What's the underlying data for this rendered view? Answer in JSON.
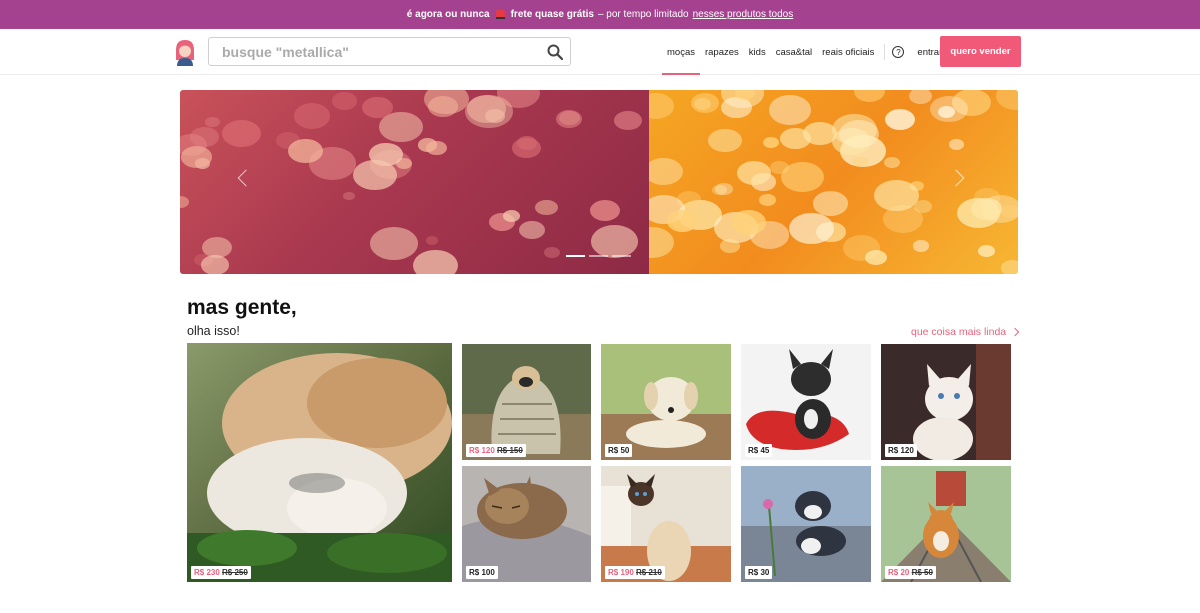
{
  "promo": {
    "part1": "é agora ou nunca",
    "part2": "frete quase grátis",
    "part3": "– por tempo limitado",
    "link": "nesses produtos todos"
  },
  "header": {
    "search_placeholder": "busque \"metallica\"",
    "nav": [
      "moças",
      "rapazes",
      "kids",
      "casa&tal",
      "reais oficiais"
    ],
    "active_nav": "moças",
    "login": "entrar",
    "sell_button": "quero vender",
    "help_glyph": "?"
  },
  "carousel": {
    "slide_count": 3,
    "active_slide": 1
  },
  "section": {
    "title": "mas gente,",
    "subtitle": "olha isso!",
    "see_more": "que coisa mais linda"
  },
  "products": [
    {
      "name": "cat-and-dog",
      "price": "R$ 230",
      "old_price": "R$ 250"
    },
    {
      "name": "pug-in-blanket",
      "price": "R$ 120",
      "old_price": "R$ 150"
    },
    {
      "name": "labrador-puppy",
      "price": "R$ 50",
      "old_price": ""
    },
    {
      "name": "french-bulldog",
      "price": "R$ 45",
      "old_price": ""
    },
    {
      "name": "white-kitten",
      "price": "R$ 120",
      "old_price": ""
    },
    {
      "name": "sleeping-tabby",
      "price": "R$ 100",
      "old_price": ""
    },
    {
      "name": "siamese-cat",
      "price": "R$ 190",
      "old_price": "R$ 210"
    },
    {
      "name": "playful-kitten",
      "price": "R$ 30",
      "old_price": ""
    },
    {
      "name": "corgi-on-tracks",
      "price": "R$ 20",
      "old_price": "R$ 50"
    }
  ],
  "colors": {
    "promo_bg": "#a5428f",
    "accent": "#f05a78",
    "link": "#e8627c"
  }
}
